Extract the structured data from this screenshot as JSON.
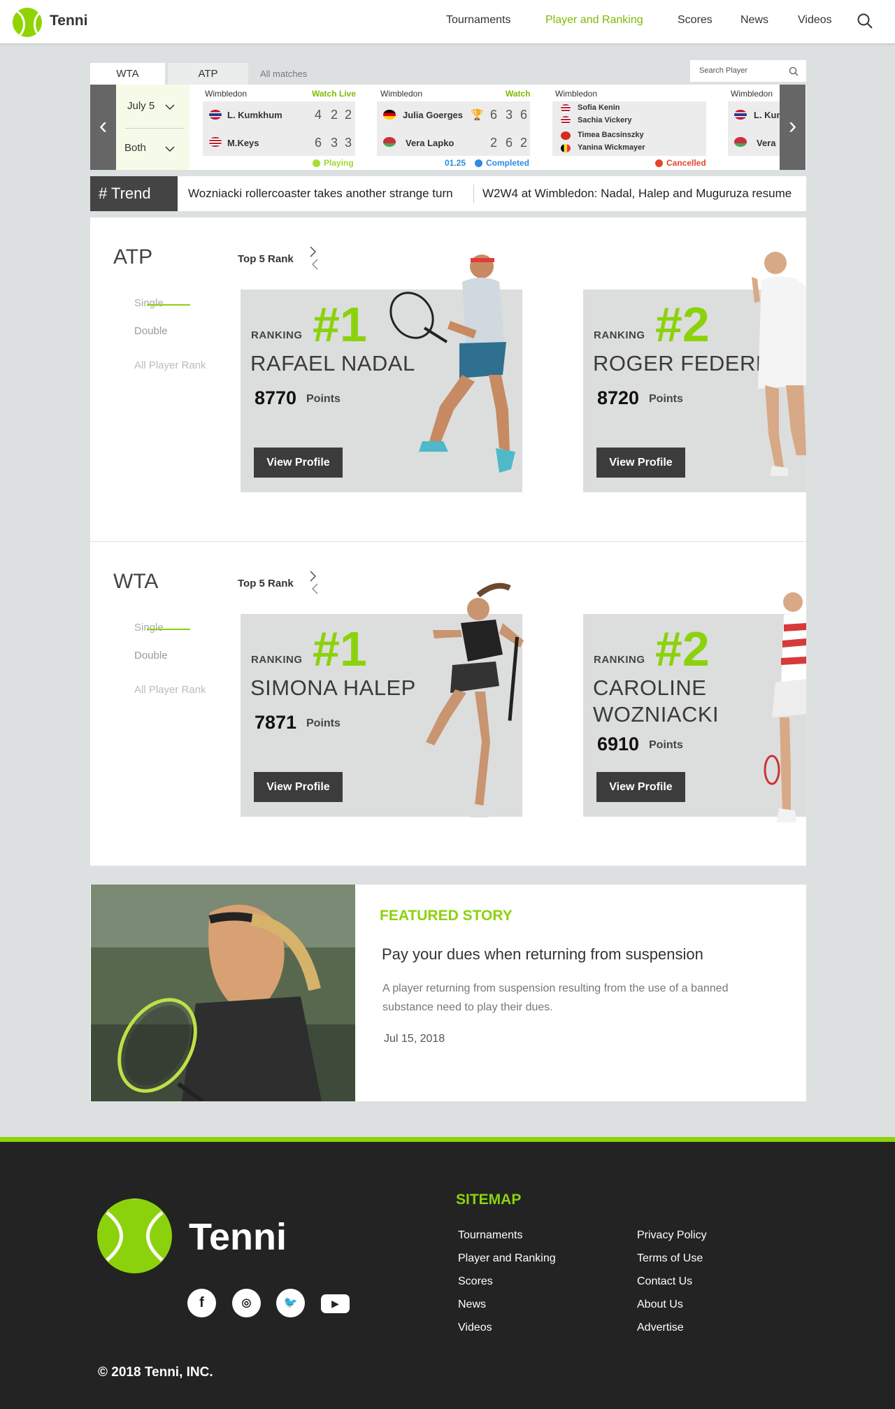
{
  "header": {
    "brand": "Tenni",
    "nav": [
      "Tournaments",
      "Player and Ranking",
      "Scores",
      "News",
      "Videos"
    ],
    "active": "Player and Ranking"
  },
  "tabs": {
    "wta": "WTA",
    "atp": "ATP",
    "all": "All matches"
  },
  "search": {
    "placeholder": "Search Player"
  },
  "filters": {
    "date": "July 5",
    "gender": "Both"
  },
  "matches": [
    {
      "event": "Wimbledon",
      "link": "Watch Live",
      "players": [
        {
          "name": "L. Kumkhum",
          "scores": [
            "4",
            "2",
            "2"
          ]
        },
        {
          "name": "M.Keys",
          "scores": [
            "6",
            "3",
            "3"
          ]
        }
      ],
      "status": "Playing"
    },
    {
      "event": "Wimbledon",
      "link": "Watch",
      "players": [
        {
          "name": "Julia Goerges",
          "scores": [
            "6",
            "3",
            "6"
          ]
        },
        {
          "name": "Vera Lapko",
          "scores": [
            "2",
            "6",
            "2"
          ]
        }
      ],
      "time": "01.25",
      "status": "Completed"
    },
    {
      "event": "Wimbledon",
      "players": [
        "Sofia Kenin",
        "Sachia Vickery",
        "Timea Bacsinszky",
        "Yanina Wickmayer"
      ],
      "status": "Cancelled"
    },
    {
      "event": "Wimbledon",
      "players": [
        {
          "name": "L. Kum"
        },
        {
          "name": "Vera"
        }
      ]
    }
  ],
  "trend": {
    "label": "# Trend",
    "items": [
      "Wozniacki rollercoaster takes another strange turn",
      "W2W4 at Wimbledon: Nadal, Halep and Muguruza resume"
    ]
  },
  "atp": {
    "title": "ATP",
    "top5": "Top 5 Rank",
    "menu": [
      "Single",
      "Double",
      "All Player Rank"
    ],
    "players": [
      {
        "ranking_label": "RANKING",
        "rank": "#1",
        "name": "RAFAEL NADAL",
        "points": "8770",
        "points_label": "Points",
        "button": "View Profile"
      },
      {
        "ranking_label": "RANKING",
        "rank": "#2",
        "name": "ROGER FEDERER",
        "points": "8720",
        "points_label": "Points",
        "button": "View Profile"
      }
    ]
  },
  "wta": {
    "title": "WTA",
    "top5": "Top 5 Rank",
    "menu": [
      "Single",
      "Double",
      "All Player Rank"
    ],
    "players": [
      {
        "ranking_label": "RANKING",
        "rank": "#1",
        "name": "SIMONA HALEP",
        "points": "7871",
        "points_label": "Points",
        "button": "View Profile"
      },
      {
        "ranking_label": "RANKING",
        "rank": "#2",
        "name": "CAROLINE WOZNIACKI",
        "name_line1": "CAROLINE",
        "name_line2": "WOZNIACKI",
        "points": "6910",
        "points_label": "Points",
        "button": "View Profile"
      }
    ]
  },
  "featured": {
    "label": "FEATURED STORY",
    "title": "Pay your dues when returning from suspension",
    "body": "A player returning from suspension resulting from the use of a banned substance need to play their dues.",
    "date": "Jul 15, 2018"
  },
  "footer": {
    "brand": "Tenni",
    "sitemap_title": "SITEMAP",
    "col1": [
      "Tournaments",
      "Player and Ranking",
      "Scores",
      "News",
      "Videos"
    ],
    "col2": [
      "Privacy Policy",
      "Terms of Use",
      "Contact Us",
      "About Us",
      "Advertise"
    ],
    "social": [
      "facebook-icon",
      "instagram-icon",
      "twitter-icon",
      "youtube-icon"
    ],
    "copyright": "© 2018 Tenni, INC."
  },
  "colors": {
    "accent": "#8cd20c",
    "dark": "#232323",
    "live": "#7dbb00",
    "completed": "#2f8ae0",
    "cancelled": "#e2462b"
  }
}
